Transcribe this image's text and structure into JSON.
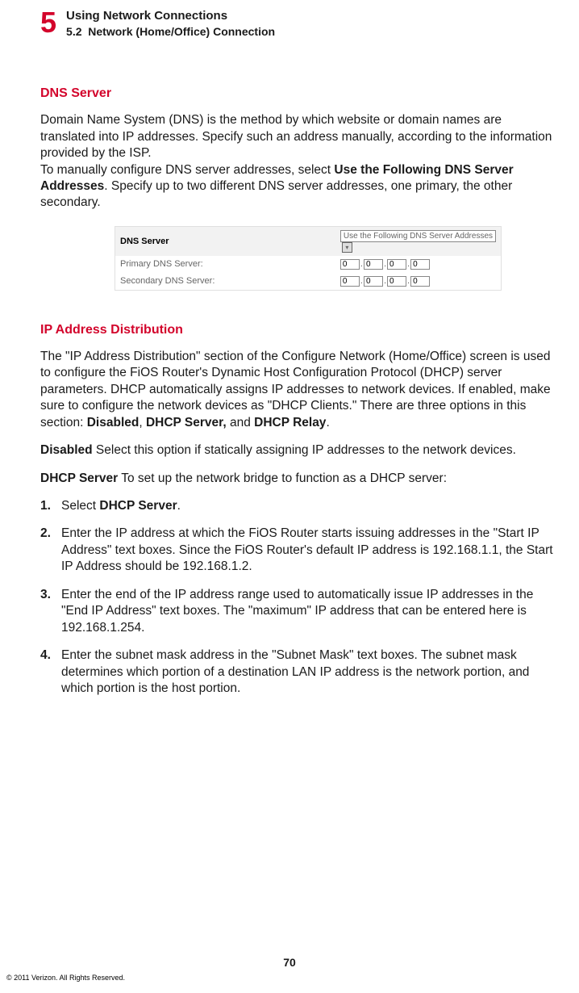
{
  "chapter": {
    "number": "5",
    "title": "Using Network Connections",
    "section_num": "5.2",
    "section_title": "Network (Home/Office) Connection"
  },
  "dns": {
    "heading": "DNS Server",
    "p1": "Domain Name System (DNS) is the method by which website or domain names are translated into IP addresses. Specify such an address manually, according to the information provided by the ISP.",
    "p2a": "To manually configure DNS server addresses, select ",
    "p2bold": "Use the Following DNS Server Addresses",
    "p2b": ". Specify up to two different DNS server addresses, one primary, the other secondary."
  },
  "figure": {
    "header_label": "DNS Server",
    "select_value": "Use the Following DNS Server Addresses",
    "row1_label": "Primary DNS Server:",
    "row2_label": "Secondary DNS Server:",
    "oct": "0"
  },
  "ipdist": {
    "heading": "IP Address Distribution",
    "p1a": "The \"IP Address Distribution\" section of the Configure Network (Home/Office) screen is used to configure the FiOS Router's Dynamic Host Configuration Protocol (DHCP) server parameters. DHCP automatically assigns IP addresses to network devices. If enabled, make sure to configure the network devices as \"DHCP Clients.\" There are three options in this section: ",
    "opt1": "Disabled",
    "sep1": ", ",
    "opt2": "DHCP Server,",
    "sep2": " and ",
    "opt3": "DHCP Relay",
    "p1b": ".",
    "disabled_label": "Disabled",
    "disabled_text": "  Select this option if statically assigning IP addresses to the network devices.",
    "dhcp_label": "DHCP Server",
    "dhcp_text": "  To set up the network bridge to function as a DHCP server:",
    "steps": [
      {
        "num": "1.",
        "a": "Select ",
        "bold": "DHCP Server",
        "b": "."
      },
      {
        "num": "2.",
        "text": "Enter the IP address at which the FiOS Router starts issuing addresses in the \"Start IP Address\" text boxes. Since the FiOS Router's default IP address is 192.168.1.1, the Start IP Address should be 192.168.1.2."
      },
      {
        "num": "3.",
        "text": "Enter the end of the IP address range used to automatically issue IP addresses in the \"End IP Address\" text boxes. The \"maximum\" IP address that can be entered here is 192.168.1.254."
      },
      {
        "num": "4.",
        "text": "Enter the subnet mask address in the \"Subnet Mask\" text boxes. The subnet mask determines which portion of a destination LAN IP address is the network portion, and which portion is the host portion."
      }
    ]
  },
  "page_number": "70",
  "copyright": "© 2011 Verizon. All Rights Reserved."
}
